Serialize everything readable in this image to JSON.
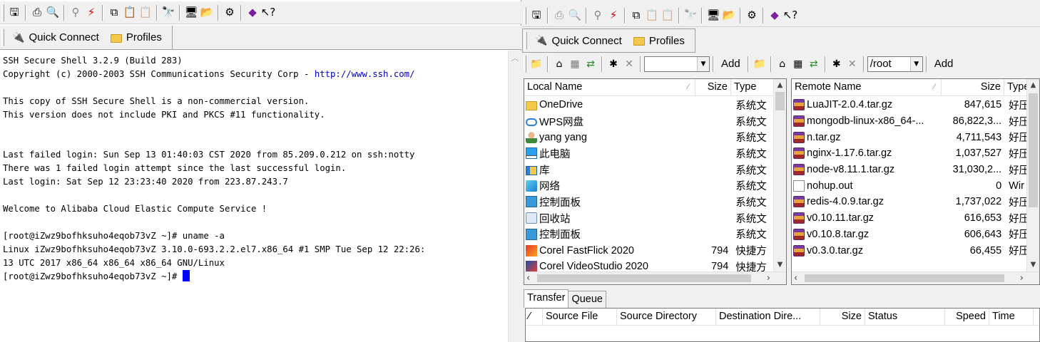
{
  "terminal_window": {
    "toolbar_icons": [
      "save-icon",
      "print-icon",
      "print-preview-icon",
      "connect-icon",
      "disconnect-icon",
      "copy-icon",
      "paste-icon",
      "paste-special-icon",
      "find-icon",
      "new-terminal-icon",
      "new-file-transfer-icon",
      "settings-icon",
      "help-book-icon",
      "context-help-icon"
    ],
    "quick_connect_label": "Quick Connect",
    "profiles_label": "Profiles",
    "lines": [
      "SSH Secure Shell 3.2.9 (Build 283)",
      "Copyright (c) 2000-2003 SSH Communications Security Corp - ",
      "",
      "This copy of SSH Secure Shell is a non-commercial version.",
      "This version does not include PKI and PKCS #11 functionality.",
      "",
      "",
      "Last failed login: Sun Sep 13 01:40:03 CST 2020 from 85.209.0.212 on ssh:notty",
      "There was 1 failed login attempt since the last successful login.",
      "Last login: Sat Sep 12 23:23:40 2020 from 223.87.243.7",
      "",
      "Welcome to Alibaba Cloud Elastic Compute Service !",
      "",
      "[root@iZwz9bofhksuho4eqob73vZ ~]# uname -a",
      "Linux iZwz9bofhksuho4eqob73vZ 3.10.0-693.2.2.el7.x86_64 #1 SMP Tue Sep 12 22:26:",
      "13 UTC 2017 x86_64 x86_64 x86_64 GNU/Linux",
      "[root@iZwz9bofhksuho4eqob73vZ ~]# "
    ],
    "copyright_link": "http://www.ssh.com/"
  },
  "file_transfer_window": {
    "quick_connect_label": "Quick Connect",
    "profiles_label": "Profiles",
    "local": {
      "path": "",
      "add_label": "Add",
      "columns": [
        "Local Name",
        "Size",
        "Type"
      ],
      "rows": [
        {
          "name": "OneDrive",
          "size": "",
          "type": "系统文",
          "icon": "folder-icon"
        },
        {
          "name": "WPS网盘",
          "size": "",
          "type": "系统文",
          "icon": "cloud-icon"
        },
        {
          "name": "yang yang",
          "size": "",
          "type": "系统文",
          "icon": "user-icon"
        },
        {
          "name": "此电脑",
          "size": "",
          "type": "系统文",
          "icon": "computer-icon"
        },
        {
          "name": "库",
          "size": "",
          "type": "系统文",
          "icon": "library-icon"
        },
        {
          "name": "网络",
          "size": "",
          "type": "系统文",
          "icon": "network-icon"
        },
        {
          "name": "控制面板",
          "size": "",
          "type": "系统文",
          "icon": "control-panel-icon"
        },
        {
          "name": "回收站",
          "size": "",
          "type": "系统文",
          "icon": "recycle-bin-icon"
        },
        {
          "name": "控制面板",
          "size": "",
          "type": "系统文",
          "icon": "control-panel-icon"
        },
        {
          "name": "Corel FastFlick 2020",
          "size": "794",
          "type": "快捷方",
          "icon": "corel-fastflick-icon"
        },
        {
          "name": "Corel VideoStudio 2020",
          "size": "794",
          "type": "快捷方",
          "icon": "corel-videostudio-icon"
        }
      ]
    },
    "remote": {
      "path": "/root",
      "add_label": "Add",
      "columns": [
        "Remote Name",
        "Size",
        "Type"
      ],
      "rows": [
        {
          "name": "LuaJIT-2.0.4.tar.gz",
          "size": "847,615",
          "type": "好压",
          "icon": "archive-icon"
        },
        {
          "name": "mongodb-linux-x86_64-...",
          "size": "86,822,3...",
          "type": "好压",
          "icon": "archive-icon"
        },
        {
          "name": "n.tar.gz",
          "size": "4,711,543",
          "type": "好压",
          "icon": "archive-icon"
        },
        {
          "name": "nginx-1.17.6.tar.gz",
          "size": "1,037,527",
          "type": "好压",
          "icon": "archive-icon"
        },
        {
          "name": "node-v8.11.1.tar.gz",
          "size": "31,030,2...",
          "type": "好压",
          "icon": "archive-icon"
        },
        {
          "name": "nohup.out",
          "size": "0",
          "type": "Wir",
          "icon": "text-file-icon"
        },
        {
          "name": "redis-4.0.9.tar.gz",
          "size": "1,737,022",
          "type": "好压",
          "icon": "archive-icon"
        },
        {
          "name": "v0.10.11.tar.gz",
          "size": "616,653",
          "type": "好压",
          "icon": "archive-icon"
        },
        {
          "name": "v0.10.8.tar.gz",
          "size": "606,643",
          "type": "好压",
          "icon": "archive-icon"
        },
        {
          "name": "v0.3.0.tar.gz",
          "size": "66,455",
          "type": "好压",
          "icon": "archive-icon"
        }
      ]
    },
    "transfer_tabs": [
      "Transfer",
      "Queue"
    ],
    "transfer_columns": [
      "Source File",
      "Source Directory",
      "Destination Dire...",
      "Size",
      "Status",
      "Speed",
      "Time"
    ]
  },
  "colors": {
    "window_bg": "#f0f0f0",
    "terminal_bg": "#ffffff",
    "link": "#0000c0",
    "cursor": "#0000ff"
  }
}
